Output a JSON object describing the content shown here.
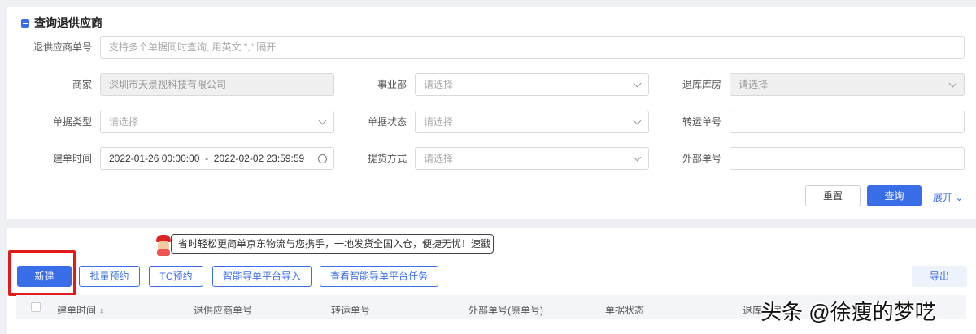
{
  "section_title": "查询退供应商",
  "form": {
    "supplier_no": {
      "label": "退供应商单号",
      "placeholder": "支持多个单据同时查询, 用英文 \",\" 隔开"
    },
    "merchant": {
      "label": "商家",
      "value": "深圳市天景视科技有限公司"
    },
    "division": {
      "label": "事业部",
      "placeholder": "请选择"
    },
    "warehouse": {
      "label": "退库库房",
      "placeholder": "请选择"
    },
    "doc_type": {
      "label": "单据类型",
      "placeholder": "请选择"
    },
    "doc_status": {
      "label": "单据状态",
      "placeholder": "请选择"
    },
    "transfer_no": {
      "label": "转运单号"
    },
    "created_time": {
      "label": "建单时间",
      "start": "2022-01-26 00:00:00",
      "sep": "-",
      "end": "2022-02-02 23:59:59"
    },
    "pickup": {
      "label": "提货方式",
      "placeholder": "请选择"
    },
    "external_no": {
      "label": "外部单号"
    }
  },
  "actions": {
    "reset": "重置",
    "query": "查询",
    "expand": "展开"
  },
  "tooltip": "省时轻松更简单京东物流与您携手，一地发货全国入仓，便捷无忧！速戳",
  "toolbar": {
    "new": "新建",
    "batch": "批量预约",
    "tc": "TC预约",
    "smart_import": "智能导单平台导入",
    "smart_tasks": "查看智能导单平台任务",
    "export": "导出"
  },
  "table": {
    "columns": [
      "建单时间",
      "退供应商单号",
      "转运单号",
      "外部单号(原单号)",
      "单据状态",
      "退库库房"
    ]
  },
  "watermark": "头条 @徐瘦的梦呓"
}
